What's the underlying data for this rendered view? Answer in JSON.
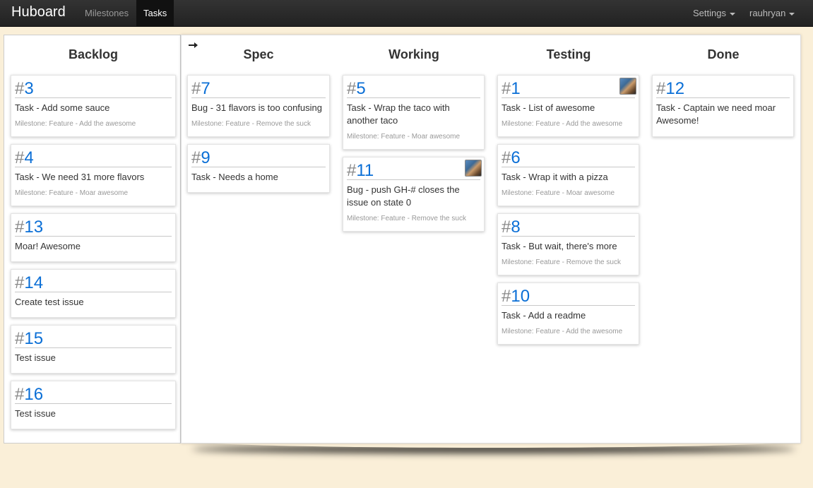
{
  "nav": {
    "brand": "Huboard",
    "links": [
      "Milestones",
      "Tasks"
    ],
    "active": "Tasks",
    "right": [
      "Settings",
      "rauhryan"
    ]
  },
  "columns": [
    {
      "title": "Backlog",
      "cards": [
        {
          "num": "3",
          "title": "Task - Add some sauce",
          "milestone": "Milestone: Feature - Add the awesome"
        },
        {
          "num": "4",
          "title": "Task - We need 31 more flavors",
          "milestone": "Milestone: Feature - Moar awesome"
        },
        {
          "num": "13",
          "title": "Moar! Awesome",
          "milestone": ""
        },
        {
          "num": "14",
          "title": "Create test issue",
          "milestone": ""
        },
        {
          "num": "15",
          "title": "Test issue",
          "milestone": ""
        },
        {
          "num": "16",
          "title": "Test issue",
          "milestone": ""
        }
      ]
    },
    {
      "title": "Spec",
      "cards": [
        {
          "num": "7",
          "title": "Bug - 31 flavors is too confusing",
          "milestone": "Milestone: Feature - Remove the suck"
        },
        {
          "num": "9",
          "title": "Task - Needs a home",
          "milestone": ""
        }
      ]
    },
    {
      "title": "Working",
      "cards": [
        {
          "num": "5",
          "title": "Task - Wrap the taco with another taco",
          "milestone": "Milestone: Feature - Moar awesome"
        },
        {
          "num": "11",
          "title": "Bug - push GH-# closes the issue on state 0",
          "milestone": "Milestone: Feature - Remove the suck",
          "avatar": true
        }
      ]
    },
    {
      "title": "Testing",
      "cards": [
        {
          "num": "1",
          "title": "Task - List of awesome",
          "milestone": "Milestone: Feature - Add the awesome",
          "avatar": true
        },
        {
          "num": "6",
          "title": "Task - Wrap it with a pizza",
          "milestone": "Milestone: Feature - Moar awesome"
        },
        {
          "num": "8",
          "title": "Task - But wait, there's more",
          "milestone": "Milestone: Feature - Remove the suck"
        },
        {
          "num": "10",
          "title": "Task - Add a readme",
          "milestone": "Milestone: Feature - Add the awesome"
        }
      ]
    },
    {
      "title": "Done",
      "cards": [
        {
          "num": "12",
          "title": "Task - Captain we need moar Awesome!",
          "milestone": ""
        }
      ]
    }
  ],
  "icons": {
    "move_column": "arrow-right-icon",
    "dropdown": "caret-down-icon",
    "assignee": "avatar"
  },
  "colors": {
    "background": "#faefd8",
    "issue_number": "#0b6fd6",
    "navbar": "#222222"
  }
}
